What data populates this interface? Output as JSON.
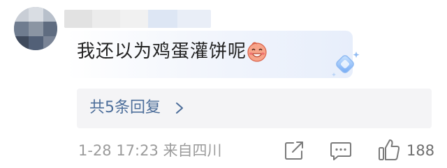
{
  "comment": {
    "text": "我还以为鸡蛋灌饼呢",
    "emoji_icon": "grinning-blush-emoji",
    "badge_icon": "diamond-badge-icon"
  },
  "replies": {
    "label": "共5条回复",
    "chevron_icon": "chevron-right-icon"
  },
  "meta": {
    "timestamp": "1-28 17:23",
    "location": "来自四川"
  },
  "actions": {
    "share_icon": "share-icon",
    "comment_icon": "comment-icon",
    "like_icon": "thumbs-up-icon",
    "like_count": "188"
  },
  "colors": {
    "reply_link": "#4d6e9a",
    "meta_text": "#9b9b9b",
    "reply_bg": "#f4f4f6"
  }
}
